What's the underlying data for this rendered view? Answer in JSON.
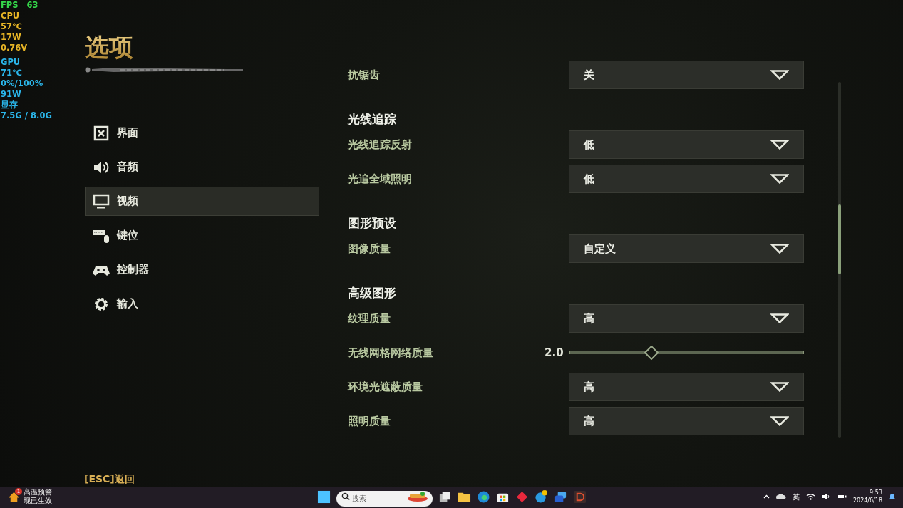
{
  "overlay": [
    {
      "color": "#35d64a",
      "lines": [
        {
          "label": "FPS",
          "value": "63"
        }
      ]
    },
    {
      "color": "#e7b526",
      "lines": [
        {
          "label": "CPU"
        },
        {
          "label": "57℃"
        },
        {
          "label": "17W"
        },
        {
          "label": "0.76V"
        }
      ]
    },
    {
      "color": "#2bb6ea",
      "lines": [
        {
          "label": "GPU"
        },
        {
          "label": "71℃"
        },
        {
          "label": "0%/100%"
        },
        {
          "label": "91W"
        },
        {
          "label": "显存"
        },
        {
          "label": "7.5G / 8.0G"
        }
      ]
    }
  ],
  "title": "选项",
  "menu": [
    {
      "kind": "interface",
      "label": "界面",
      "selected": false
    },
    {
      "kind": "audio",
      "label": "音频",
      "selected": false
    },
    {
      "kind": "video",
      "label": "视频",
      "selected": true
    },
    {
      "kind": "keyboard",
      "label": "键位",
      "selected": false
    },
    {
      "kind": "controller",
      "label": "控制器",
      "selected": false
    },
    {
      "kind": "gear",
      "label": "输入",
      "selected": false
    }
  ],
  "settings": [
    {
      "kind": "dropdown",
      "label": "抗锯齿",
      "value": "关"
    },
    {
      "kind": "header",
      "label": "光线追踪"
    },
    {
      "kind": "dropdown",
      "label": "光线追踪反射",
      "value": "低"
    },
    {
      "kind": "dropdown",
      "label": "光追全域照明",
      "value": "低"
    },
    {
      "kind": "header",
      "label": "图形预设"
    },
    {
      "kind": "dropdown",
      "label": "图像质量",
      "value": "自定义"
    },
    {
      "kind": "header",
      "label": "高级图形"
    },
    {
      "kind": "dropdown",
      "label": "纹理质量",
      "value": "高"
    },
    {
      "kind": "slider",
      "label": "无线网格网络质量",
      "reading": "2.0",
      "level": 0.35
    },
    {
      "kind": "dropdown",
      "label": "环境光遮蔽质量",
      "value": "高"
    },
    {
      "kind": "dropdown",
      "label": "照明质量",
      "value": "高"
    }
  ],
  "back_hint": "[ESC]返回",
  "taskbar": {
    "weather": {
      "badge": "1",
      "line_1": "高温预警",
      "line_2": "现已生效"
    },
    "search": {
      "placeholder": "搜索"
    },
    "tray": {
      "language": "英",
      "time": "9:53",
      "date": "2024/6/18"
    }
  }
}
